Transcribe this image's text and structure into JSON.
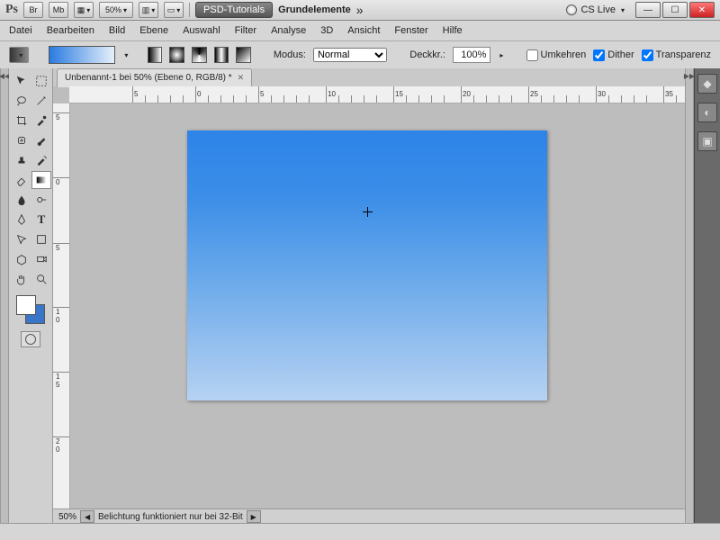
{
  "titlebar": {
    "ps": "Ps",
    "br": "Br",
    "mb": "Mb",
    "zoom": "50%",
    "psd_tutorials": "PSD-Tutorials",
    "workspace": "Grundelemente",
    "cslive": "CS Live"
  },
  "menu": [
    "Datei",
    "Bearbeiten",
    "Bild",
    "Ebene",
    "Auswahl",
    "Filter",
    "Analyse",
    "3D",
    "Ansicht",
    "Fenster",
    "Hilfe"
  ],
  "options": {
    "modus": "Modus:",
    "modus_val": "Normal",
    "deckkr": "Deckkr.:",
    "deckkr_val": "100%",
    "umkehren": "Umkehren",
    "dither": "Dither",
    "transparenz": "Transparenz"
  },
  "doc": {
    "tab": "Unbenannt-1 bei 50% (Ebene 0, RGB/8) *"
  },
  "ruler_h": [
    {
      "p": 70,
      "l": "5"
    },
    {
      "p": 140,
      "l": "0"
    },
    {
      "p": 210,
      "l": "5"
    },
    {
      "p": 285,
      "l": "10"
    },
    {
      "p": 360,
      "l": "15"
    },
    {
      "p": 435,
      "l": "20"
    },
    {
      "p": 510,
      "l": "25"
    },
    {
      "p": 585,
      "l": "30"
    },
    {
      "p": 660,
      "l": "35"
    }
  ],
  "ruler_v": [
    {
      "p": 10,
      "l": "5"
    },
    {
      "p": 82,
      "l": "0"
    },
    {
      "p": 155,
      "l": "5"
    },
    {
      "p": 226,
      "l": "1\n0"
    },
    {
      "p": 298,
      "l": "1\n5"
    },
    {
      "p": 370,
      "l": "2\n0"
    }
  ],
  "status": {
    "zoom": "50%",
    "msg": "Belichtung funktioniert nur bei 32-Bit"
  },
  "swatch": {
    "fg": "#ffffff",
    "bg": "#3a76c8"
  }
}
